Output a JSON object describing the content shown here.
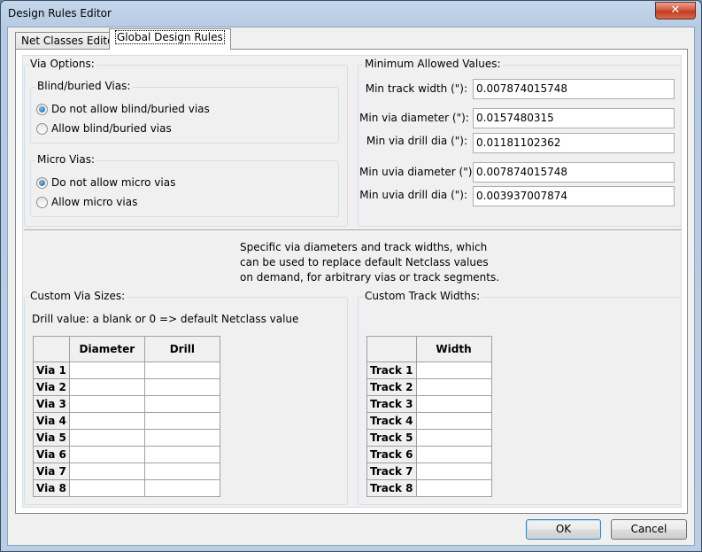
{
  "window": {
    "title": "Design Rules Editor",
    "close_glyph": "✕"
  },
  "tabs": [
    {
      "label": "Net Classes Editor"
    },
    {
      "label": "Global Design Rules"
    }
  ],
  "via_options": {
    "label": "Via Options:",
    "blind_buried": {
      "label": "Blind/buried Vias:",
      "options": [
        "Do not allow blind/buried vias",
        "Allow blind/buried vias"
      ],
      "selected_index": 0
    },
    "micro": {
      "label": "Micro Vias:",
      "options": [
        "Do not allow micro vias",
        "Allow micro vias"
      ],
      "selected_index": 0
    }
  },
  "minimum_values": {
    "label": "Minimum Allowed Values:",
    "fields": [
      {
        "label": "Min track width (\"):",
        "value": "0.007874015748"
      },
      {
        "label": "Min via diameter (\"):",
        "value": "0.0157480315"
      },
      {
        "label": "Min via drill dia (\"):",
        "value": "0.01181102362"
      },
      {
        "label": "Min uvia diameter (\"):",
        "value": "0.007874015748"
      },
      {
        "label": "Min uvia drill dia (\"):",
        "value": "0.003937007874"
      }
    ]
  },
  "description": [
    "Specific via diameters and track widths, which",
    "can be used to replace default Netclass values",
    "on demand, for arbitrary vias or track segments."
  ],
  "custom_via_sizes": {
    "label": "Custom Via Sizes:",
    "hint": "Drill value: a blank or 0 => default Netclass value",
    "columns": [
      "Diameter",
      "Drill"
    ],
    "rows": [
      "Via 1",
      "Via 2",
      "Via 3",
      "Via 4",
      "Via 5",
      "Via 6",
      "Via 7",
      "Via 8"
    ]
  },
  "custom_track_widths": {
    "label": "Custom Track Widths:",
    "columns": [
      "Width"
    ],
    "rows": [
      "Track 1",
      "Track 2",
      "Track 3",
      "Track 4",
      "Track 5",
      "Track 6",
      "Track 7",
      "Track 8"
    ]
  },
  "buttons": {
    "ok": "OK",
    "cancel": "Cancel"
  }
}
